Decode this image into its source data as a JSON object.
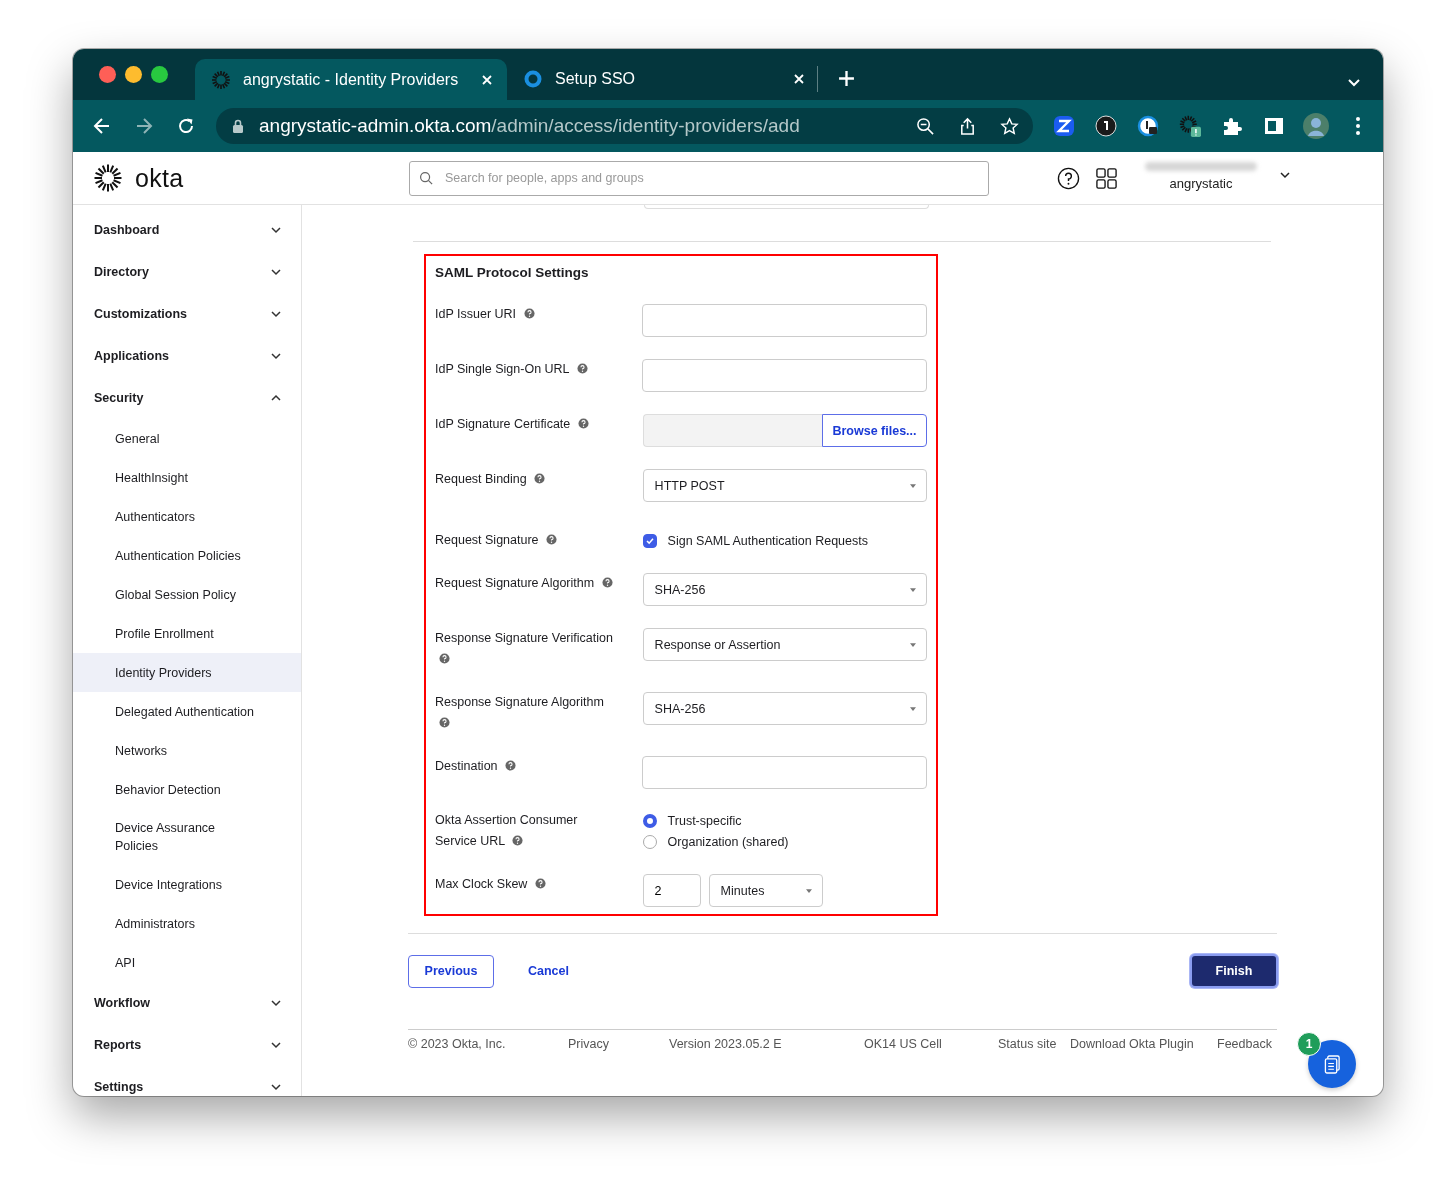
{
  "browser": {
    "tabs": [
      {
        "title": "angrystatic - Identity Providers",
        "selected": true
      },
      {
        "title": "Setup SSO",
        "selected": false
      }
    ],
    "url": {
      "host": "angrystatic-admin.okta.com",
      "path": "/admin/access/identity-providers/add"
    }
  },
  "header": {
    "logo": "okta",
    "search": {
      "placeholder": "Search for people, apps and groups"
    },
    "org": "angrystatic"
  },
  "sidebar": {
    "items": [
      {
        "label": "Dashboard",
        "expanded": false
      },
      {
        "label": "Directory",
        "expanded": false
      },
      {
        "label": "Customizations",
        "expanded": false
      },
      {
        "label": "Applications",
        "expanded": false
      },
      {
        "label": "Security",
        "expanded": true,
        "children": [
          {
            "label": "General",
            "selected": false
          },
          {
            "label": "HealthInsight",
            "selected": false
          },
          {
            "label": "Authenticators",
            "selected": false
          },
          {
            "label": "Authentication Policies",
            "selected": false
          },
          {
            "label": "Global Session Policy",
            "selected": false
          },
          {
            "label": "Profile Enrollment",
            "selected": false
          },
          {
            "label": "Identity Providers",
            "selected": true
          },
          {
            "label": "Delegated Authentication",
            "selected": false
          },
          {
            "label": "Networks",
            "selected": false
          },
          {
            "label": "Behavior Detection",
            "selected": false
          },
          {
            "label": "Device Assurance Policies",
            "selected": false
          },
          {
            "label": "Device Integrations",
            "selected": false
          },
          {
            "label": "Administrators",
            "selected": false
          },
          {
            "label": "API",
            "selected": false
          }
        ]
      },
      {
        "label": "Workflow",
        "expanded": false
      },
      {
        "label": "Reports",
        "expanded": false
      },
      {
        "label": "Settings",
        "expanded": false
      }
    ]
  },
  "form": {
    "title": "SAML Protocol Settings",
    "fields": [
      {
        "kind": "text",
        "label": "IdP Issuer URI"
      },
      {
        "kind": "text",
        "label": "IdP Single Sign-On URL"
      },
      {
        "kind": "file",
        "label": "IdP Signature Certificate",
        "button": "Browse files..."
      },
      {
        "kind": "select",
        "label": "Request Binding",
        "value": "HTTP POST"
      },
      {
        "kind": "checkbox",
        "label": "Request Signature",
        "option": "Sign SAML Authentication Requests",
        "checked": true
      },
      {
        "kind": "select",
        "label": "Request Signature Algorithm",
        "value": "SHA-256"
      },
      {
        "kind": "select",
        "label": "Response Signature Verification",
        "value": "Response or Assertion"
      },
      {
        "kind": "select",
        "label": "Response Signature Algorithm",
        "value": "SHA-256"
      },
      {
        "kind": "text",
        "label": "Destination"
      },
      {
        "kind": "radio",
        "label": "Okta Assertion Consumer Service URL",
        "options": [
          {
            "label": "Trust-specific",
            "selected": true
          },
          {
            "label": "Organization (shared)",
            "selected": false
          }
        ]
      },
      {
        "kind": "duration",
        "label": "Max Clock Skew",
        "value": "2",
        "unit": "Minutes"
      }
    ]
  },
  "actions": {
    "previous": "Previous",
    "cancel": "Cancel",
    "finish": "Finish"
  },
  "footer": {
    "items": [
      "© 2023 Okta, Inc.",
      "Privacy",
      "Version 2023.05.2 E",
      "OK14 US Cell",
      "Status site",
      "Download Okta Plugin",
      "Feedback"
    ]
  },
  "help_button": {
    "badge": "1"
  }
}
